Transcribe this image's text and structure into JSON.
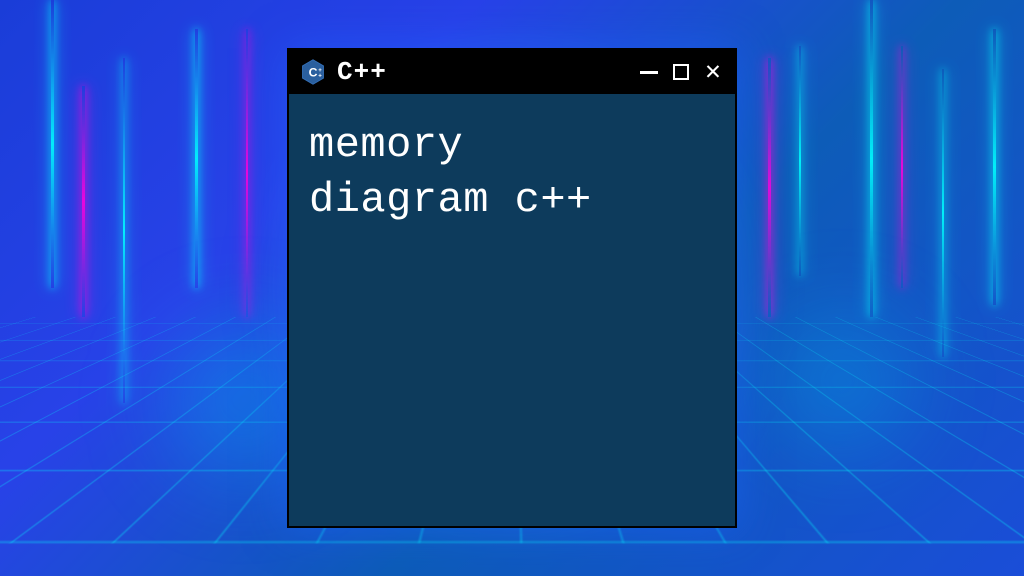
{
  "window": {
    "title": "C++",
    "icon_label": "C++"
  },
  "terminal": {
    "content_line1": "memory",
    "content_line2": "diagram c++"
  },
  "colors": {
    "terminal_bg": "#0d3b5c",
    "titlebar_bg": "#000000",
    "text": "#ffffff",
    "accent_cyan": "#00ffff",
    "accent_magenta": "#ff00dd"
  }
}
